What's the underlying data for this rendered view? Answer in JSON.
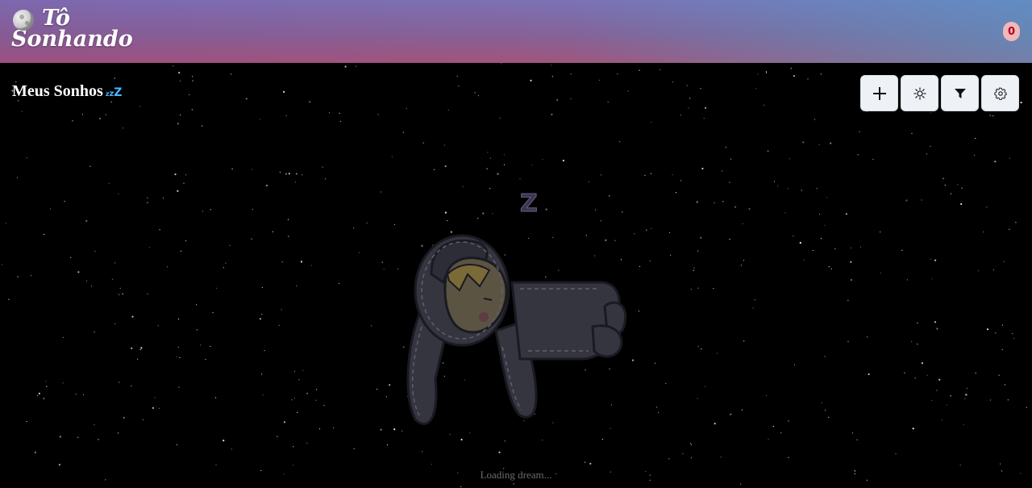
{
  "header": {
    "logo_line1": "Tô",
    "logo_line2": "Sonhando",
    "logo_icon": "moon-icon",
    "badge_count": "0"
  },
  "main": {
    "title": "Meus Sonhos",
    "title_icon": "zzz-icon",
    "toolbar": [
      {
        "name": "add",
        "icon": "plus-icon"
      },
      {
        "name": "theme",
        "icon": "sun-icon"
      },
      {
        "name": "filter",
        "icon": "filter-icon"
      },
      {
        "name": "settings",
        "icon": "gear-icon"
      }
    ],
    "sleep_mark": "Z",
    "loading_text": "Loading dream..."
  },
  "colors": {
    "background": "#000000",
    "badge_bg": "#f0b8b8",
    "badge_text": "#b3002a",
    "zzz": "#4ab6ff"
  }
}
